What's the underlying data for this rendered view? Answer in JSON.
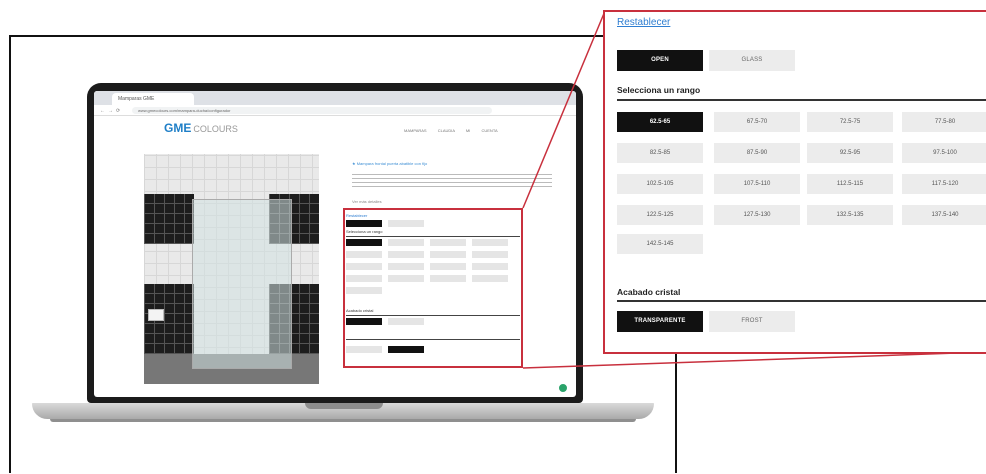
{
  "browser": {
    "tab_title": "Mamparas GME",
    "url": "www.gmecolours.com/mampara-ducha/configurador"
  },
  "site": {
    "logo_main": "GME",
    "logo_sub": "COLOURS",
    "nav": "MAMPARAS   CLAUDIA   MI CUENTA"
  },
  "product": {
    "info_line": "★ Mampara frontal puerta abatible con fijo",
    "link": "Ver más detalles"
  },
  "zoom": {
    "reset_label": "Restablecer",
    "type_buttons": [
      "OPEN",
      "GLASS"
    ],
    "range_title": "Selecciona un rango",
    "ranges": [
      "62.5-65",
      "67.5-70",
      "72.5-75",
      "77.5-80",
      "82.5-85",
      "87.5-90",
      "92.5-95",
      "97.5-100",
      "102.5-105",
      "107.5-110",
      "112.5-115",
      "117.5-120",
      "122.5-125",
      "127.5-130",
      "132.5-135",
      "137.5-140",
      "142.5-145"
    ],
    "finish_title": "Acabado cristal",
    "finish_buttons": [
      "TRANSPARENTE",
      "FROST"
    ]
  },
  "colors": {
    "accent_red": "#c8303d",
    "link_blue": "#2f7ed1",
    "selected": "#111111",
    "fab_green": "#2aa36a"
  }
}
